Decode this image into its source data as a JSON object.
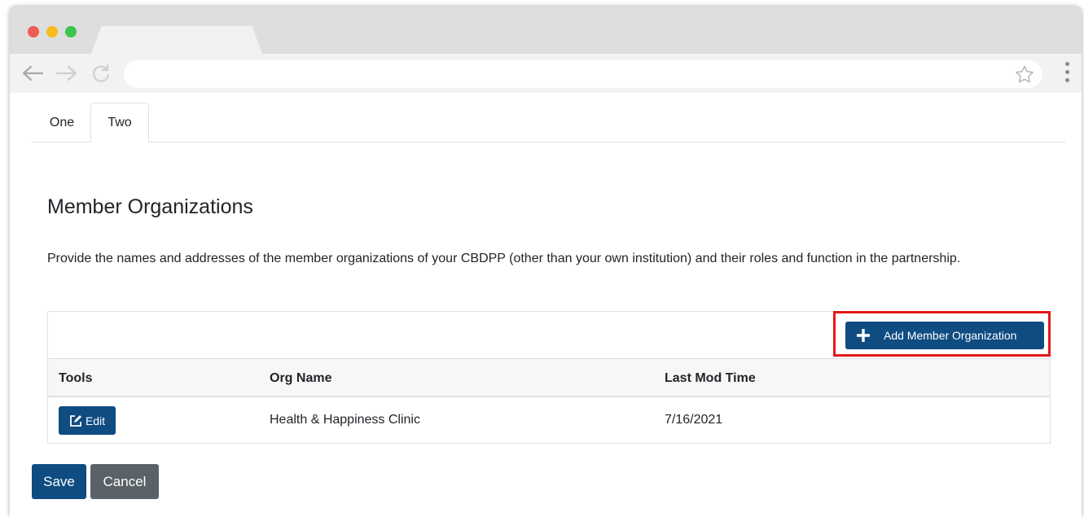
{
  "browser": {
    "back_icon": "arrow-left-icon",
    "forward_icon": "arrow-right-icon",
    "reload_icon": "reload-icon",
    "bookmark_icon": "star-icon",
    "menu_icon": "vertical-dots-icon",
    "url": ""
  },
  "tabs": [
    {
      "label": "One",
      "active": false
    },
    {
      "label": "Two",
      "active": true
    }
  ],
  "section": {
    "title": "Member Organizations",
    "description": "Provide the names and addresses of the member organizations of your CBDPP (other than your own institution) and their roles and function in the partnership."
  },
  "table": {
    "add_button_label": "Add Member Organization",
    "add_button_icon": "plus-icon",
    "columns": [
      "Tools",
      "Org Name",
      "Last Mod Time"
    ],
    "rows": [
      {
        "tool_label": "Edit",
        "tool_icon": "edit-icon",
        "org_name": "Health & Happiness Clinic",
        "last_mod_time": "7/16/2021"
      }
    ]
  },
  "actions": {
    "save_label": "Save",
    "cancel_label": "Cancel"
  },
  "colors": {
    "primary": "#0f4c81",
    "secondary": "#5a6268",
    "highlight": "#e4181b"
  }
}
